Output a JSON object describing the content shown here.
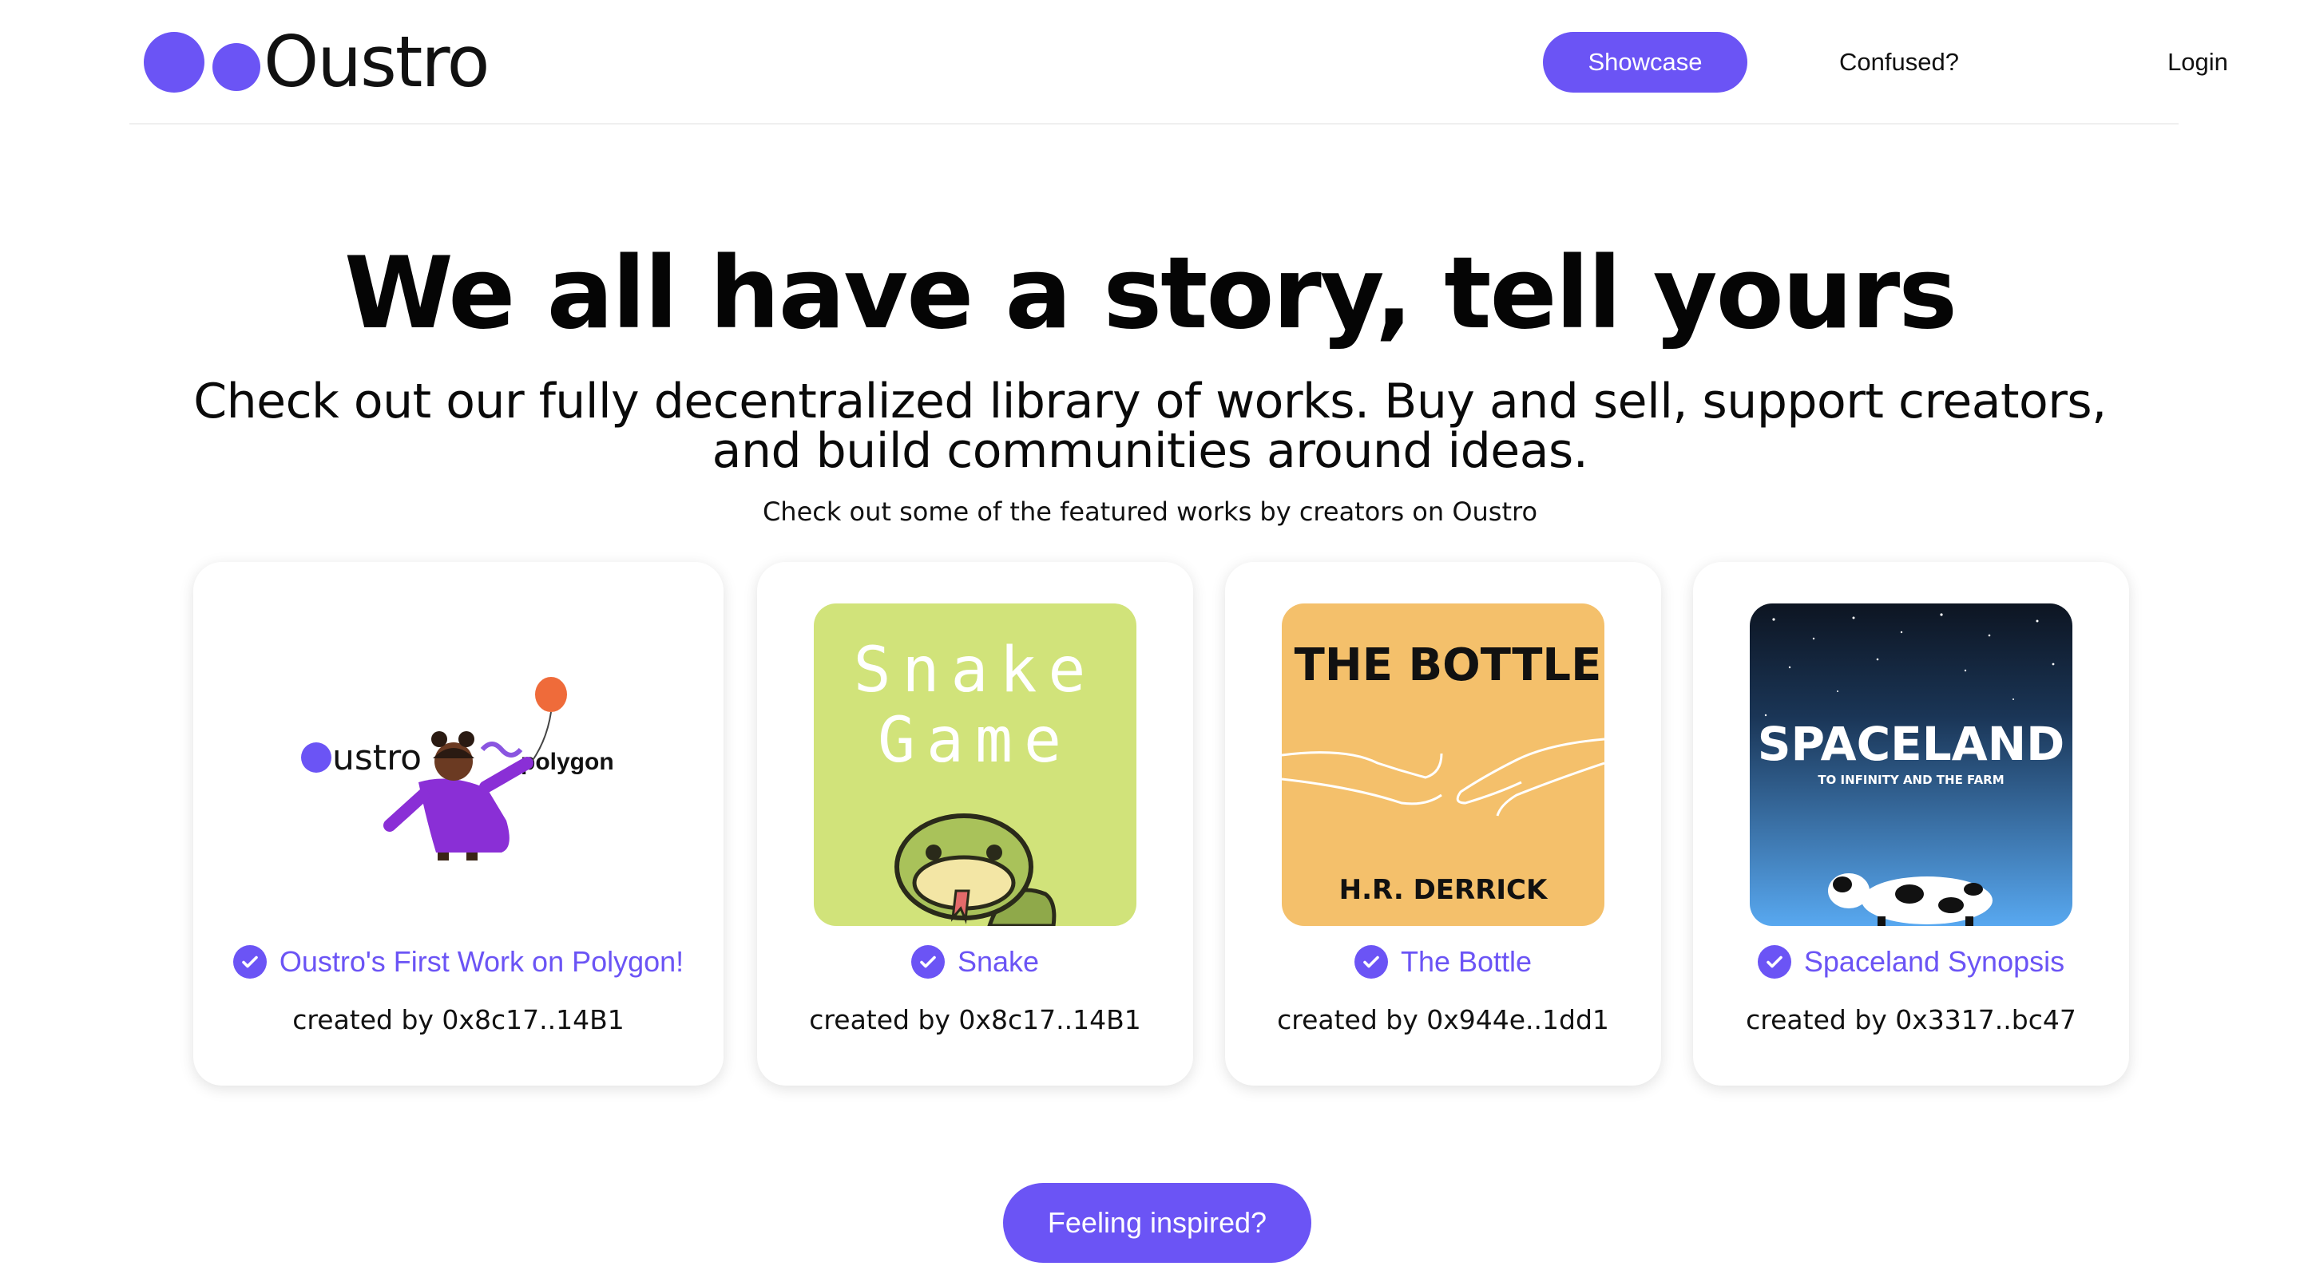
{
  "header": {
    "logo_text": "Oustro",
    "nav": {
      "showcase": "Showcase",
      "confused": "Confused?",
      "login": "Login"
    }
  },
  "hero": {
    "title": "We all have a story, tell yours",
    "subtitle_line1": "Check out our fully decentralized library of works. Buy and sell, support creators,",
    "subtitle_line2": "and build communities around ideas.",
    "featured_note": "Check out some of the featured works by creators on Oustro"
  },
  "cards": [
    {
      "title": "Oustro's First Work on Polygon!",
      "creator": "created by 0x8c17..14B1",
      "image": {
        "logo_left": "ustro",
        "logo_right": "polygon"
      }
    },
    {
      "title": "Snake",
      "creator": "created by 0x8c17..14B1",
      "image": {
        "line1": "Snake",
        "line2": "Game",
        "bg": "#d1e37a"
      }
    },
    {
      "title": "The Bottle",
      "creator": "created by 0x944e..1dd1",
      "image": {
        "heading": "THE BOTTLE",
        "author": "H.R. DERRICK",
        "bg": "#f4c06b"
      }
    },
    {
      "title": "Spaceland Synopsis",
      "creator": "created by 0x3317..bc47",
      "image": {
        "heading": "SPACELAND",
        "tagline": "TO INFINITY AND THE FARM"
      }
    }
  ],
  "cta": {
    "label": "Feeling inspired?"
  },
  "colors": {
    "accent": "#6b54f5",
    "text": "#0a0a0a",
    "card_bg": "#ffffff"
  }
}
